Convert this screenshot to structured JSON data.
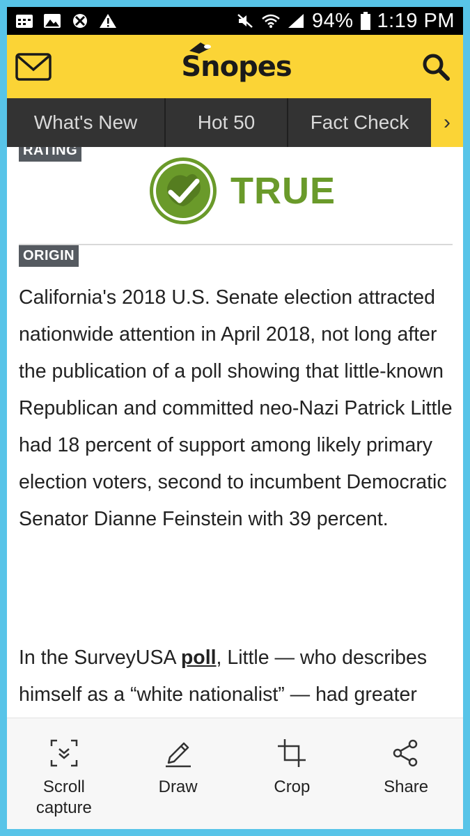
{
  "status_bar": {
    "left_icons": [
      "calendar-icon",
      "image-icon",
      "blocked-icon",
      "warning-icon"
    ],
    "right_icons": [
      "mute-icon",
      "wifi-icon",
      "signal-icon"
    ],
    "battery": "94%",
    "time": "1:19 PM"
  },
  "header": {
    "logo_text": "Snopes",
    "left_icon": "mail-icon",
    "right_icon": "search-icon",
    "brand_color": "#fbd436"
  },
  "nav": {
    "items": [
      {
        "label": "What's New"
      },
      {
        "label": "Hot 50"
      },
      {
        "label": "Fact Check"
      }
    ],
    "more_icon": "chevron-right-icon"
  },
  "article": {
    "rating_tag": "RATING",
    "rating": "TRUE",
    "rating_color": "#6a9a2a",
    "origin_tag": "ORIGIN",
    "paragraph1": "California's 2018 U.S. Senate election attracted nationwide attention in April 2018, not long after the publication of a poll showing that little-known Republican and committed neo-Nazi Patrick Little had 18 percent of support among likely primary election voters, second to incumbent Democratic Senator Dianne Feinstein with 39 percent.",
    "paragraph2_before": "In the SurveyUSA ",
    "paragraph2_link": "poll",
    "paragraph2_after": ", Little — who describes himself as a “white nationalist” — had greater support than four other"
  },
  "toolbar": {
    "items": [
      {
        "label": "Scroll capture",
        "icon": "scroll-capture-icon"
      },
      {
        "label": "Draw",
        "icon": "pencil-icon"
      },
      {
        "label": "Crop",
        "icon": "crop-icon"
      },
      {
        "label": "Share",
        "icon": "share-icon"
      }
    ]
  }
}
